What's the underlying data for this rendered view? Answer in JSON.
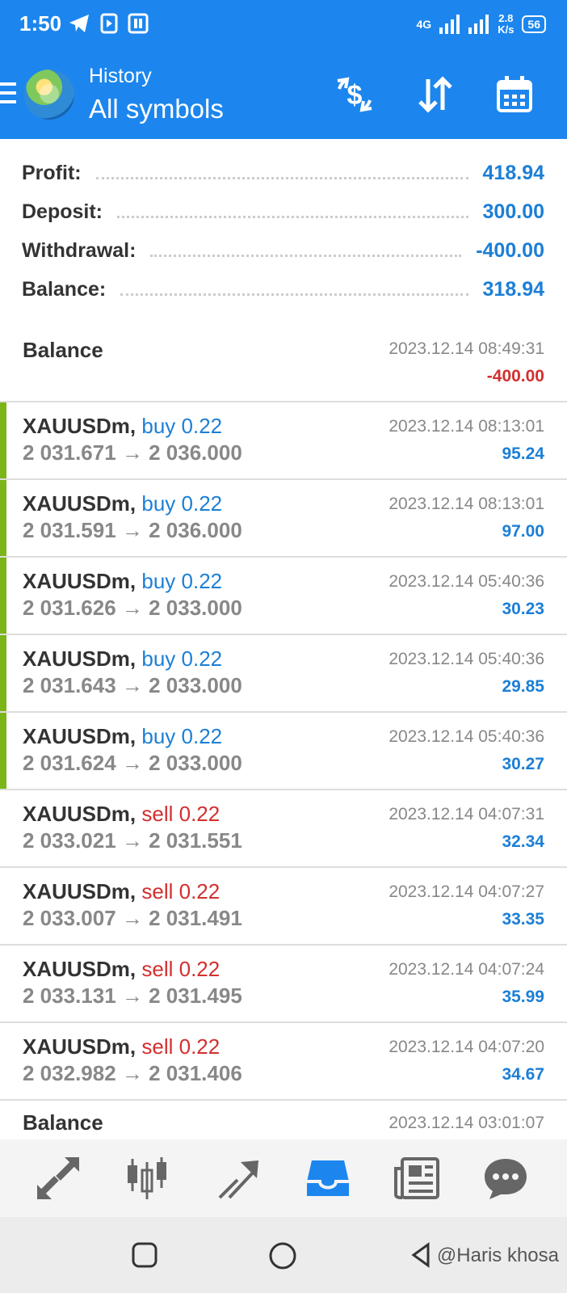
{
  "status_bar": {
    "time": "1:50",
    "network": "4G",
    "speed_value": "2.8",
    "speed_unit": "K/s",
    "battery": "56"
  },
  "header": {
    "subtitle": "History",
    "title": "All symbols"
  },
  "summary": [
    {
      "label": "Profit:",
      "value": "418.94"
    },
    {
      "label": "Deposit:",
      "value": "300.00"
    },
    {
      "label": "Withdrawal:",
      "value": "-400.00"
    },
    {
      "label": "Balance:",
      "value": "318.94"
    }
  ],
  "history": [
    {
      "kind": "balance",
      "title": "Balance",
      "time": "2023.12.14 08:49:31",
      "amount": "-400.00"
    },
    {
      "kind": "trade",
      "symbol": "XAUUSDm,",
      "side": "buy 0.22",
      "time": "2023.12.14 08:13:01",
      "prices": "2 031.671 → 2 036.000",
      "profit": "95.24"
    },
    {
      "kind": "trade",
      "symbol": "XAUUSDm,",
      "side": "buy 0.22",
      "time": "2023.12.14 08:13:01",
      "prices": "2 031.591 → 2 036.000",
      "profit": "97.00"
    },
    {
      "kind": "trade",
      "symbol": "XAUUSDm,",
      "side": "buy 0.22",
      "time": "2023.12.14 05:40:36",
      "prices": "2 031.626 → 2 033.000",
      "profit": "30.23"
    },
    {
      "kind": "trade",
      "symbol": "XAUUSDm,",
      "side": "buy 0.22",
      "time": "2023.12.14 05:40:36",
      "prices": "2 031.643 → 2 033.000",
      "profit": "29.85"
    },
    {
      "kind": "trade",
      "symbol": "XAUUSDm,",
      "side": "buy 0.22",
      "time": "2023.12.14 05:40:36",
      "prices": "2 031.624 → 2 033.000",
      "profit": "30.27"
    },
    {
      "kind": "trade",
      "symbol": "XAUUSDm,",
      "side": "sell 0.22",
      "time": "2023.12.14 04:07:31",
      "prices": "2 033.021 → 2 031.551",
      "profit": "32.34"
    },
    {
      "kind": "trade",
      "symbol": "XAUUSDm,",
      "side": "sell 0.22",
      "time": "2023.12.14 04:07:27",
      "prices": "2 033.007 → 2 031.491",
      "profit": "33.35"
    },
    {
      "kind": "trade",
      "symbol": "XAUUSDm,",
      "side": "sell 0.22",
      "time": "2023.12.14 04:07:24",
      "prices": "2 033.131 → 2 031.495",
      "profit": "35.99"
    },
    {
      "kind": "trade",
      "symbol": "XAUUSDm,",
      "side": "sell 0.22",
      "time": "2023.12.14 04:07:20",
      "prices": "2 032.982 → 2 031.406",
      "profit": "34.67"
    },
    {
      "kind": "balance",
      "title": "Balance",
      "time": "2023.12.14 03:01:07",
      "amount": ""
    }
  ],
  "bottom_nav": [
    {
      "icon": "quotes-icon"
    },
    {
      "icon": "chart-icon"
    },
    {
      "icon": "trade-icon"
    },
    {
      "icon": "history-icon",
      "active": true
    },
    {
      "icon": "news-icon"
    },
    {
      "icon": "messages-icon"
    }
  ],
  "watermark": "@Haris khosa",
  "colors": {
    "primary": "#1c86ee",
    "buy": "#1c7fd6",
    "sell": "#d32f2f",
    "buy_marker": "#7cb518"
  }
}
